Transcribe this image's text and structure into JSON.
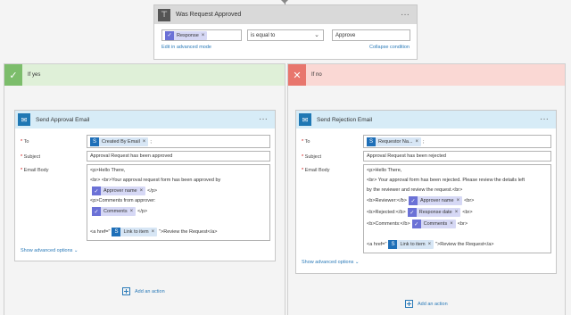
{
  "condition": {
    "title": "Was Request Approved",
    "left_token": "Response",
    "operator": "is equal to",
    "right_value": "Approve",
    "edit_advanced": "Edit in advanced mode",
    "collapse": "Collapse condition"
  },
  "yes_branch": {
    "label": "If yes",
    "card": {
      "title": "Send Approval Email",
      "to_label": "To",
      "to_token": "Created By Email",
      "to_suffix": ";",
      "subject_label": "Subject",
      "subject_value": "Approval Request has been approved",
      "body_label": "Email Body",
      "body": {
        "l1": "<p>Hello There,",
        "l2": "<br> <br>Your approval request form has been approved by",
        "l3_token": "Approver name",
        "l3_after": "</p>",
        "l4": "<p>Comments from approver:",
        "l5_token": "Comments",
        "l5_after": "</p>",
        "l6_before": "<a href=\"",
        "l6_token": "Link to item",
        "l6_after": "\">Review the Request</a>"
      },
      "show_advanced": "Show advanced options"
    },
    "add_action": "Add an action"
  },
  "no_branch": {
    "label": "If no",
    "card": {
      "title": "Send Rejection Email",
      "to_label": "To",
      "to_token": "Requestor Na...",
      "to_suffix": ";",
      "subject_label": "Subject",
      "subject_value": "Approval Request has been rejected",
      "body_label": "Email Body",
      "body": {
        "l1": "<p>Hello There,",
        "l2": "<br> Your approval form has been rejected. Please review the details left",
        "l3": "by the reviewer and review the request.<br>",
        "l4_before": "<b>Reviewer:</b>",
        "l4_token": "Approver name",
        "l4_after": "<br>",
        "l5_before": "<b>Rejected:</b>",
        "l5_token": "Response date",
        "l5_after": "<br>",
        "l6_before": "<b>Comments:</b>",
        "l6_token": "Comments",
        "l6_after": "<br>",
        "l7_before": "<a href=\"",
        "l7_token": "Link to item",
        "l7_after": "\">Review the Request</a>"
      },
      "show_advanced": "Show advanced options"
    },
    "add_action": "Add an action"
  },
  "colors": {
    "yes_accent": "#7cbd6b",
    "no_accent": "#e8766d",
    "link": "#2a7ab8",
    "token_bg": "#d6d8f5",
    "header_blue": "#d7ecf7"
  }
}
